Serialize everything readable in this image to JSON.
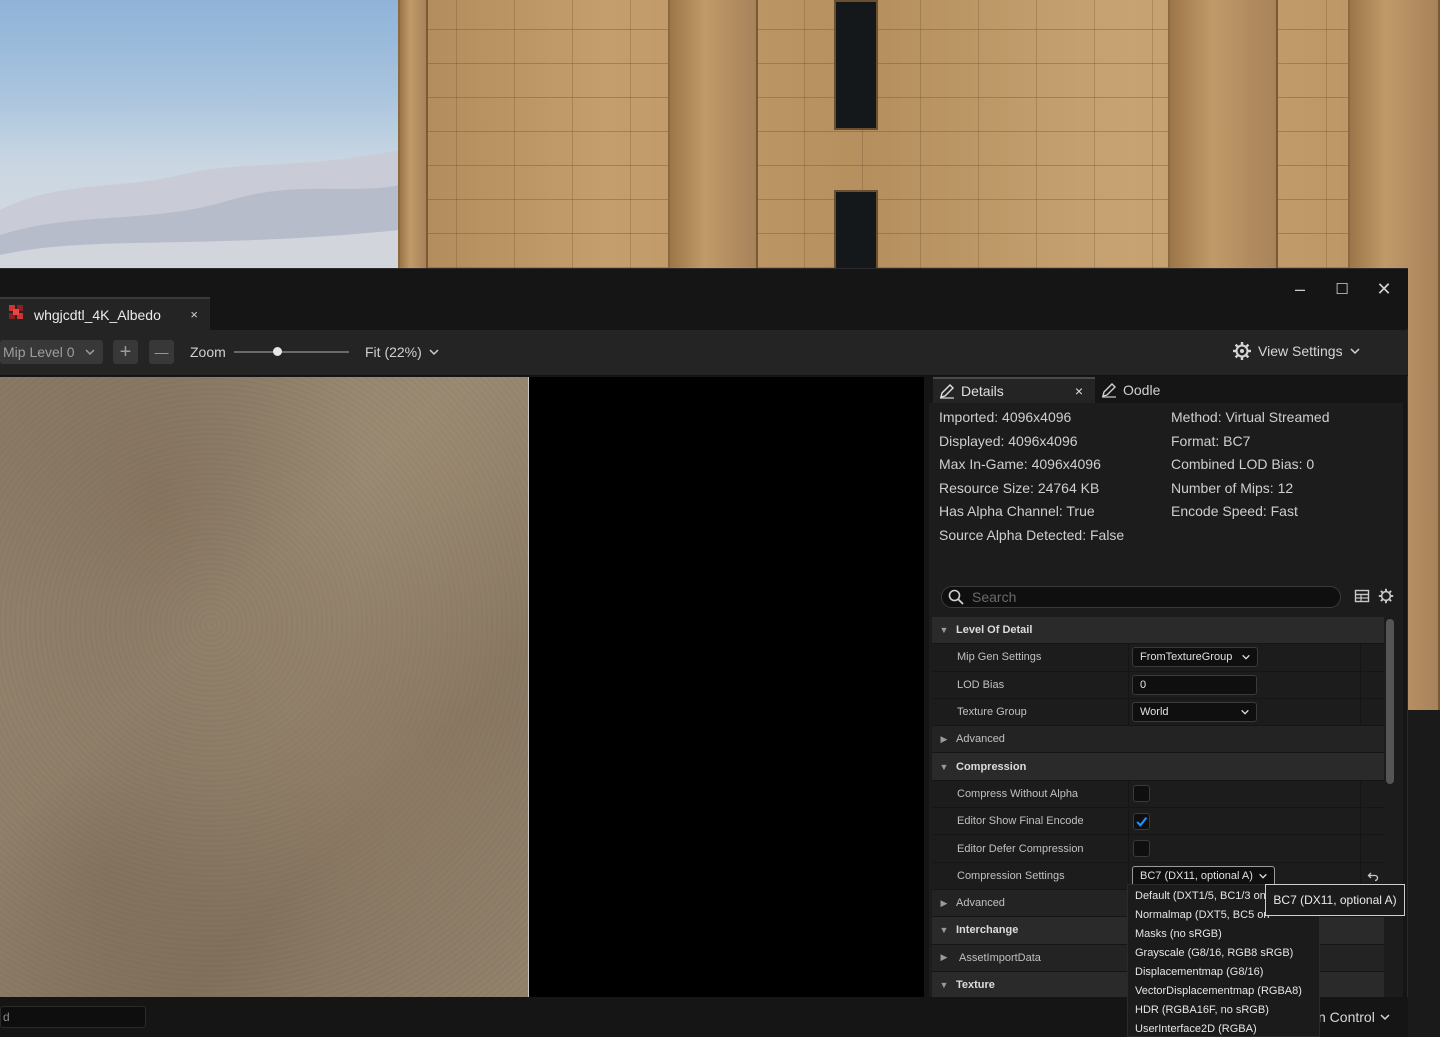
{
  "asset_tab": {
    "title": "whgjcdtl_4K_Albedo",
    "close": "×"
  },
  "window": {
    "minimize": "–",
    "maximize": "☐",
    "close": "✕"
  },
  "toolbar": {
    "mip_level": "Mip Level 0",
    "zoom_in": "+",
    "zoom_out": "—",
    "zoom_label": "Zoom",
    "zoom_level": 0.38,
    "fit": "Fit (22%)",
    "view_settings": "View Settings"
  },
  "details_panel": {
    "tab_details": "Details",
    "tab_details_close": "×",
    "tab_oodle": "Oodle",
    "info_left": [
      "Imported: 4096x4096",
      "Displayed: 4096x4096",
      "Max In-Game: 4096x4096",
      "Resource Size: 24764 KB",
      "Has Alpha Channel: True",
      "Source Alpha Detected: False"
    ],
    "info_right": [
      "Method: Virtual Streamed",
      "Format: BC7",
      "Combined LOD Bias: 0",
      "Number of Mips: 12",
      "Encode Speed: Fast"
    ],
    "search_placeholder": "Search",
    "properties": {
      "level_of_detail": "Level Of Detail",
      "mip_gen_settings_label": "Mip Gen Settings",
      "mip_gen_settings_value": "FromTextureGroup",
      "lod_bias_label": "LOD Bias",
      "lod_bias_value": "0",
      "texture_group_label": "Texture Group",
      "texture_group_value": "World",
      "advanced_1": "Advanced",
      "compression": "Compression",
      "compress_without_alpha": "Compress Without Alpha",
      "compress_without_alpha_checked": false,
      "editor_show_final_encode": "Editor Show Final Encode",
      "editor_show_final_encode_checked": true,
      "editor_defer_compression": "Editor Defer Compression",
      "editor_defer_compression_checked": false,
      "compression_settings_label": "Compression Settings",
      "compression_settings_value": "BC7 (DX11, optional A)",
      "advanced_2": "Advanced",
      "interchange": "Interchange",
      "asset_import_data": "AssetImportData",
      "texture": "Texture"
    }
  },
  "dropdown_options": [
    "Default (DXT1/5, BC1/3 on",
    "Normalmap (DXT5, BC5 on",
    "Masks (no sRGB)",
    "Grayscale (G8/16, RGB8 sRGB)",
    "Displacementmap (G8/16)",
    "VectorDisplacementmap (RGBA8)",
    "HDR (RGBA16F, no sRGB)",
    "UserInterface2D (RGBA)"
  ],
  "tooltip": "BC7 (DX11, optional A)",
  "statusbar": {
    "cmd_text": "d",
    "source_control": "n Control"
  },
  "colors": {
    "accent_check": "#1e8fff",
    "panel_bg": "#1c1c1c",
    "toolbar_bg": "#242424"
  },
  "icons": {
    "asset": "texture-asset-icon",
    "gear": "gear-icon",
    "pencil": "details-pencil-icon",
    "search": "search-icon",
    "grid": "table-view-icon",
    "reset": "reset-arrow-icon"
  }
}
